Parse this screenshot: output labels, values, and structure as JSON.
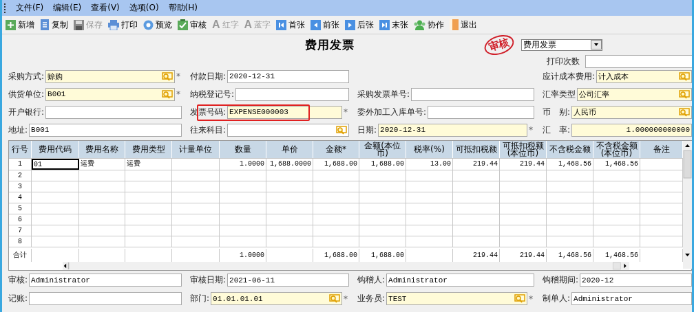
{
  "menu": [
    {
      "label": "文件(F)"
    },
    {
      "label": "编辑(E)"
    },
    {
      "label": "查看(V)"
    },
    {
      "label": "选项(O)"
    },
    {
      "label": "帮助(H)"
    }
  ],
  "toolbar": [
    {
      "label": "新增",
      "disabled": false
    },
    {
      "label": "复制",
      "disabled": false
    },
    {
      "label": "保存",
      "disabled": true
    },
    {
      "label": "打印",
      "disabled": false
    },
    {
      "label": "预览",
      "disabled": false
    },
    {
      "label": "审核",
      "disabled": false
    },
    {
      "label": "红字",
      "disabled": true,
      "glyph": "A"
    },
    {
      "label": "蓝字",
      "disabled": true,
      "glyph": "A"
    },
    {
      "label": "首张",
      "disabled": false
    },
    {
      "label": "前张",
      "disabled": false
    },
    {
      "label": "后张",
      "disabled": false
    },
    {
      "label": "末张",
      "disabled": false
    },
    {
      "label": "协作",
      "disabled": false
    },
    {
      "label": "退出",
      "disabled": false
    }
  ],
  "header": {
    "title": "费用发票",
    "stamp": "审核",
    "type_select": "费用发票",
    "print_count_label": "打印次数"
  },
  "form": {
    "rows": [
      [
        {
          "label": "采购方式:",
          "value": "赊购",
          "lookup": true,
          "highlighted": true,
          "marker": "*"
        },
        {
          "label": "付款日期:",
          "value": "2020-12-31",
          "lookup": false,
          "highlighted": false
        },
        null,
        {
          "label": "应计成本费用:",
          "value": "计入成本",
          "lookup": true,
          "highlighted": true
        }
      ],
      [
        {
          "label": "供货单位:",
          "value": "B001",
          "lookup": true,
          "highlighted": true,
          "marker": "*"
        },
        {
          "label": "纳税登记号:",
          "lookup": false,
          "highlighted": false
        },
        {
          "label": "采购发票单号:",
          "lookup": false,
          "highlighted": false
        },
        {
          "label": "汇率类型",
          "value": "公司汇率",
          "lookup": true,
          "highlighted": true
        }
      ],
      [
        {
          "label": "开户银行:",
          "lookup": false,
          "highlighted": false
        },
        {
          "label": "发票号码:",
          "value": "EXPENSE000003",
          "lookup": false,
          "highlighted": true,
          "marker": "*",
          "outlined": true
        },
        {
          "label": "委外加工入库单号:",
          "lookup": false,
          "highlighted": false
        },
        {
          "label": "币　别:",
          "value": "人民币",
          "lookup": true,
          "highlighted": true
        }
      ],
      [
        {
          "label": "地址:",
          "value": "B001",
          "lookup": false,
          "highlighted": false
        },
        {
          "label": "往来科目:",
          "lookup": true,
          "highlighted": false
        },
        {
          "label": "日期:",
          "value": "2020-12-31",
          "lookup": false,
          "highlighted": true,
          "marker": "*"
        },
        {
          "label": "汇　率:",
          "value": "1.000000000000",
          "lookup": false,
          "highlighted": true,
          "numeric": true
        }
      ]
    ]
  },
  "table": {
    "columns": [
      {
        "label": "行号"
      },
      {
        "label": "费用代码"
      },
      {
        "label": "费用名称"
      },
      {
        "label": "费用类型"
      },
      {
        "label": "计量单位"
      },
      {
        "label": "数量",
        "numeric": true
      },
      {
        "label": "单价",
        "numeric": true
      },
      {
        "label": "金额*",
        "numeric": true
      },
      {
        "label": "金额(本位币)",
        "numeric": true
      },
      {
        "label": "税率(%)",
        "numeric": true
      },
      {
        "label": "可抵扣税额",
        "numeric": true
      },
      {
        "label": "可抵扣税额(本位币)",
        "numeric": true
      },
      {
        "label": "不含税金额",
        "numeric": true
      },
      {
        "label": "不含税金额(本位币)",
        "numeric": true
      },
      {
        "label": "备注"
      }
    ],
    "rows": [
      {
        "no": "1",
        "selected": true,
        "cells": [
          "01",
          "运费",
          "运费",
          null,
          "1.0000",
          "1,688.0000",
          "1,688.00",
          "1,688.00",
          "13.00",
          "219.44",
          "219.44",
          "1,468.56",
          "1,468.56",
          null
        ]
      },
      {
        "no": "2",
        "selected": false
      },
      {
        "no": "3",
        "selected": false
      },
      {
        "no": "4",
        "selected": false
      },
      {
        "no": "5",
        "selected": false
      },
      {
        "no": "6",
        "selected": false
      },
      {
        "no": "7",
        "selected": false
      },
      {
        "no": "8",
        "selected": false
      }
    ],
    "total": {
      "label": "合计",
      "cells": [
        null,
        null,
        null,
        null,
        "1.0000",
        null,
        "1,688.00",
        "1,688.00",
        null,
        "219.44",
        "219.44",
        "1,468.56",
        "1,468.56",
        null
      ]
    }
  },
  "footer": {
    "rows": [
      [
        {
          "label": "审核:",
          "value": "Administrator",
          "lookup": false,
          "highlighted": false
        },
        {
          "label": "审核日期:",
          "value": "2021-06-11",
          "lookup": false,
          "highlighted": false
        },
        {
          "label": "钩稽人:",
          "value": "Administrator",
          "lookup": false,
          "highlighted": false
        },
        {
          "label": "钩稽期间:",
          "value": "2020-12",
          "lookup": false,
          "highlighted": false
        }
      ],
      [
        {
          "label": "记账:",
          "lookup": false,
          "highlighted": false
        },
        {
          "label": "部门:",
          "value": "01.01.01.01",
          "lookup": true,
          "highlighted": true,
          "marker": "*"
        },
        {
          "label": "业务员:",
          "value": "TEST",
          "lookup": true,
          "highlighted": true,
          "marker": "*"
        },
        {
          "label": "制单人:",
          "value": "Administrator",
          "lookup": false,
          "highlighted": false
        }
      ]
    ]
  }
}
